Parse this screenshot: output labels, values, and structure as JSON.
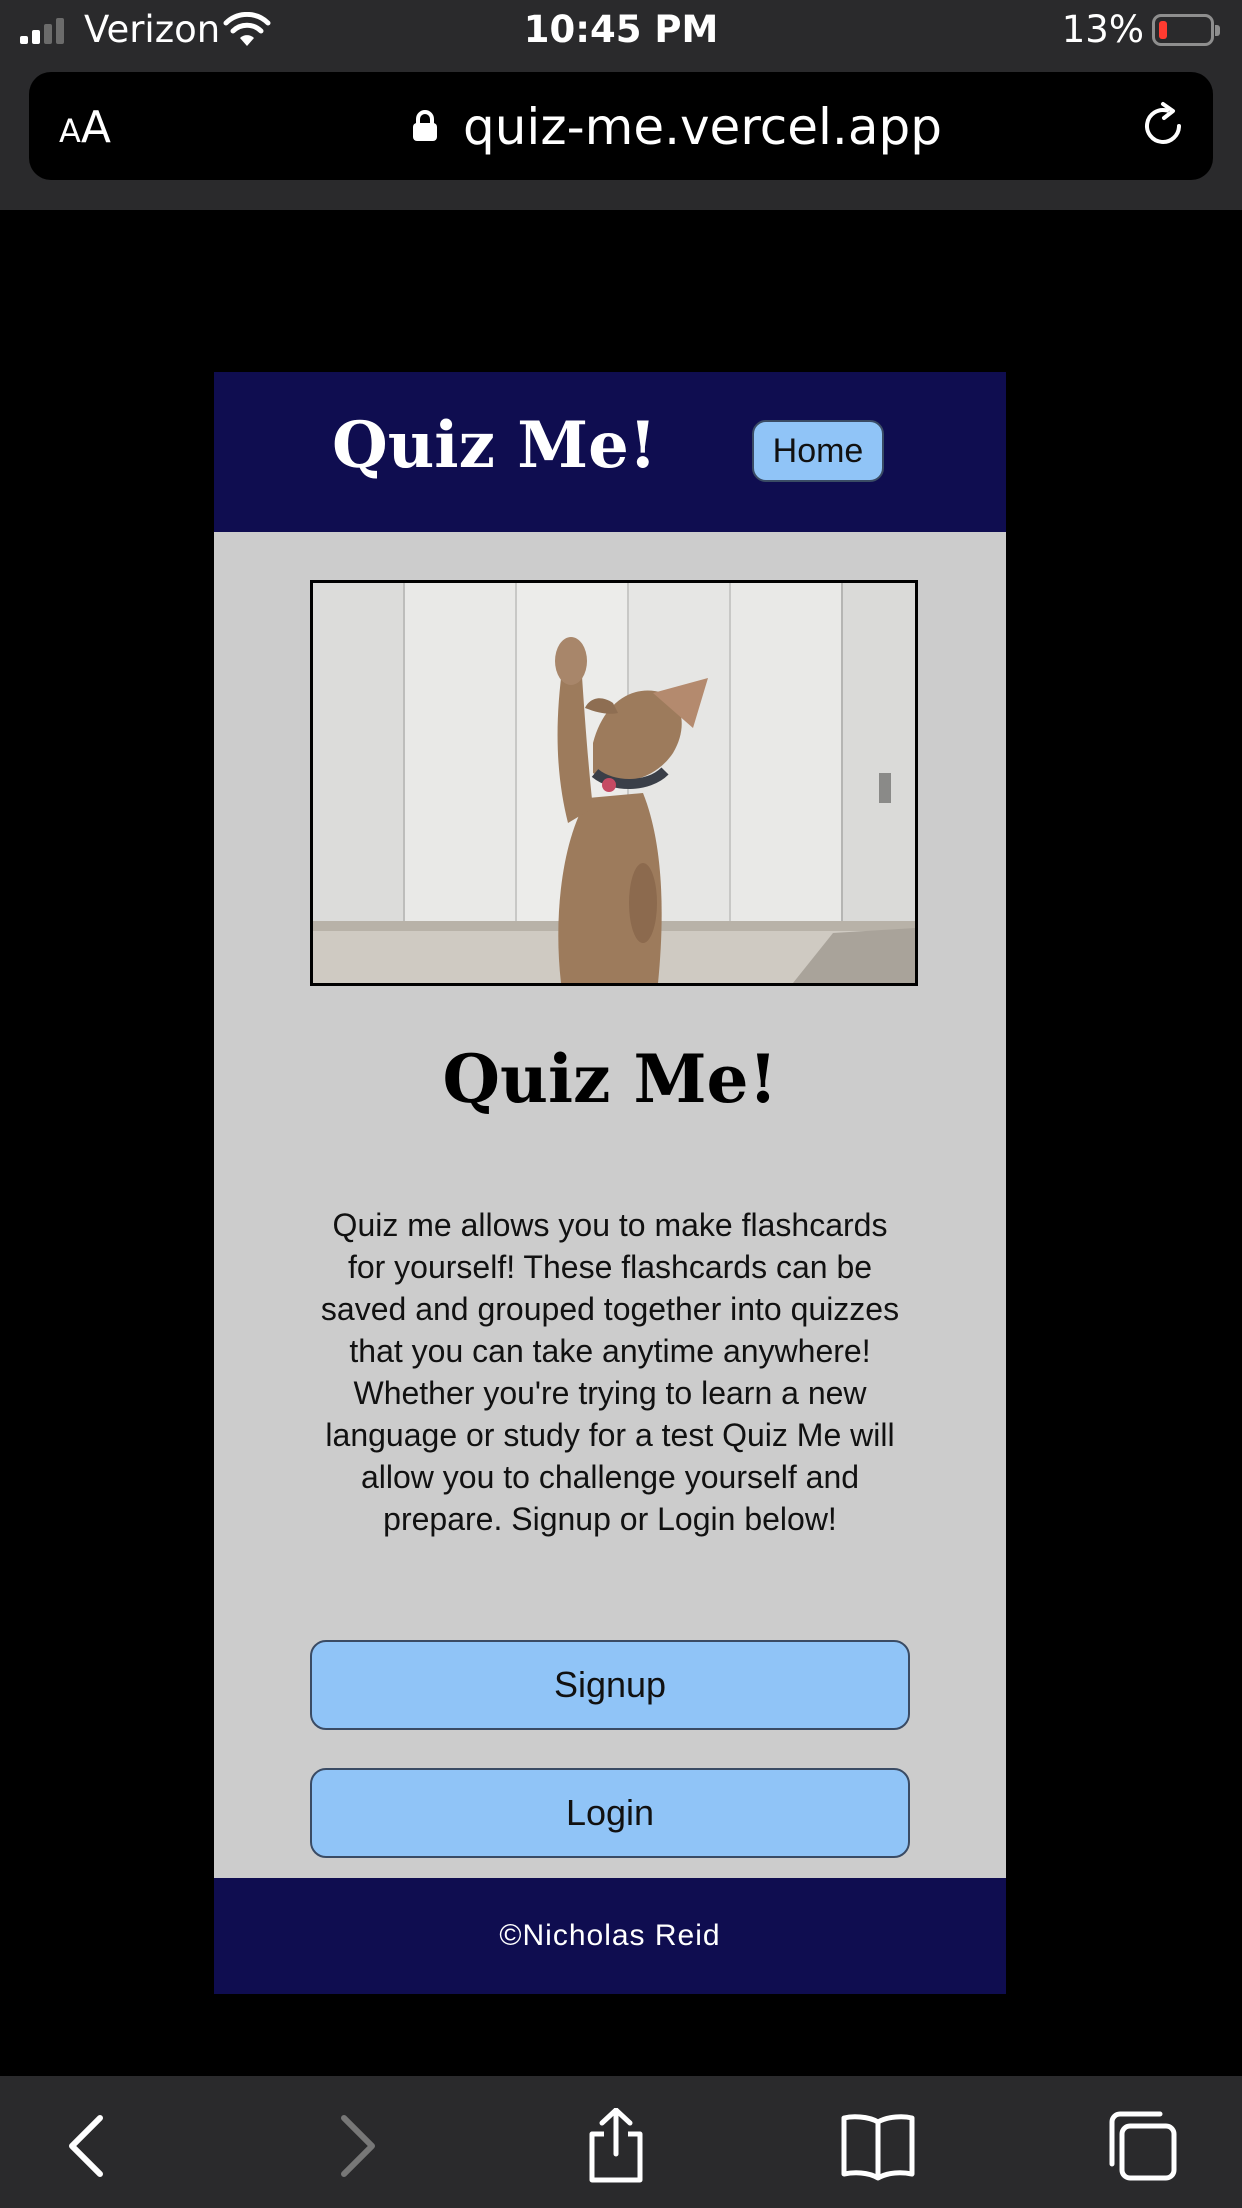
{
  "status_bar": {
    "carrier": "Verizon",
    "time": "10:45 PM",
    "battery": "13%",
    "battery_level": 0.13
  },
  "browser": {
    "text_size_label_small": "A",
    "text_size_label_large": "A",
    "url": "quiz-me.vercel.app",
    "icons": {
      "lock": "lock-icon",
      "reload": "reload-icon",
      "back": "back-icon",
      "forward": "forward-icon",
      "share": "share-icon",
      "bookmarks": "bookmarks-icon",
      "tabs": "tabs-icon"
    }
  },
  "site": {
    "header": {
      "logo": "Quiz Me!",
      "home_label": "Home"
    },
    "main": {
      "title": "Quiz Me!",
      "description": "Quiz me allows you to make flashcards for yourself! These flashcards can be saved and grouped together into quizzes that you can take anytime anywhere! Whether you're trying to learn a new language or study for a test Quiz Me will allow you to challenge yourself and prepare. Signup or Login below!",
      "signup_label": "Signup",
      "login_label": "Login"
    },
    "footer": {
      "text": "©Nicholas Reid"
    },
    "colors": {
      "header_bg": "#0f0d50",
      "main_bg": "#cccccc",
      "button_bg": "#90c4f7"
    }
  }
}
